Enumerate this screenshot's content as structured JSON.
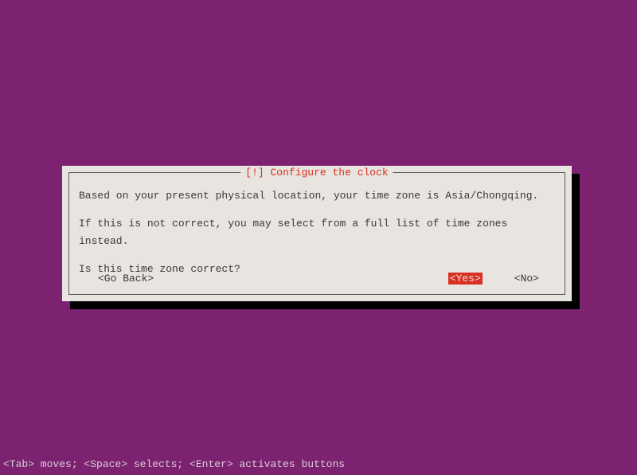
{
  "dialog": {
    "title": "[!] Configure the clock",
    "line1": "Based on your present physical location, your time zone is Asia/Chongqing.",
    "line2": "If this is not correct, you may select from a full list of time zones instead.",
    "line3": "Is this time zone correct?",
    "buttons": {
      "goback": "<Go Back>",
      "yes": "<Yes>",
      "no": "<No>"
    }
  },
  "helpbar": "<Tab> moves; <Space> selects; <Enter> activates buttons"
}
